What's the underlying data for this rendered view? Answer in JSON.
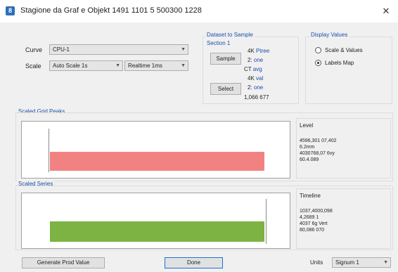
{
  "window": {
    "title": "Stagione da Graf e Objekt 1491 1101 5 500300 1228",
    "close_glyph": "✕",
    "icon_letter": "8"
  },
  "curve_row": {
    "label": "Curve",
    "value": "CPU-1"
  },
  "scale_row": {
    "label": "Scale",
    "left_value": "Auto Scale 1s",
    "right_value": "Realtime 1ms"
  },
  "dataset_group": {
    "title_line1": "Dataset to Sample",
    "title_line2": "Section 1",
    "button_top": "Sample",
    "button_bottom": "Select",
    "items": [
      {
        "prefix": "4K",
        "text": "Ptree"
      },
      {
        "prefix": "2:",
        "text": "one"
      },
      {
        "prefix": "CT",
        "text": "avg"
      },
      {
        "prefix": "4K",
        "text": "val"
      },
      {
        "prefix": "2:",
        "text": "one"
      },
      {
        "prefix": "",
        "text": "1,066 677"
      }
    ]
  },
  "display_group": {
    "title": "Display Values",
    "option_a": "Scale & Values",
    "option_b": "Labels Map",
    "selected": "b"
  },
  "section_top": {
    "title": "Scaled Grid Peaks",
    "bar_color": "#f28282",
    "bar_fill_percent": 100,
    "info_title": "Level",
    "info_lines": [
      "4596,301 07,402",
      "6.2mm",
      "4030768,07 6vy",
      "60.4.089"
    ]
  },
  "section_bottom": {
    "title": "Scaled Series",
    "bar_color": "#7cb342",
    "bar_fill_percent": 100,
    "info_title": "Timeline",
    "info_lines": [
      "1037,4000,098",
      "4,2689 1",
      "4037 6g Vert",
      "80,086 070"
    ]
  },
  "footer": {
    "left_button": "Generate Prod Value",
    "center_button": "Done",
    "units_label": "Units",
    "units_value": "Signum 1"
  }
}
